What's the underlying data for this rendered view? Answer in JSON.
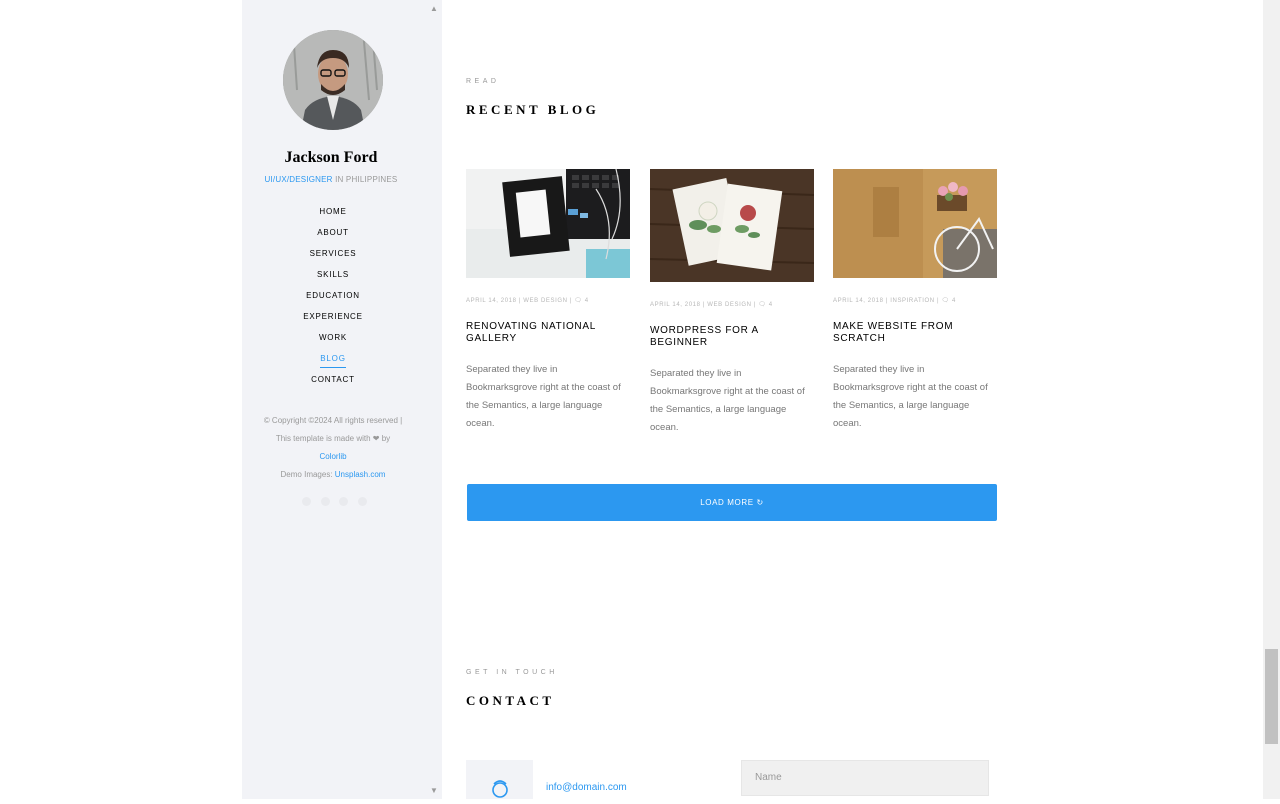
{
  "sidebar": {
    "name": "Jackson Ford",
    "role_accent": "UI/UX/DESIGNER",
    "role_rest": " IN PHILIPPINES",
    "nav": [
      {
        "label": "HOME"
      },
      {
        "label": "ABOUT"
      },
      {
        "label": "SERVICES"
      },
      {
        "label": "SKILLS"
      },
      {
        "label": "EDUCATION"
      },
      {
        "label": "EXPERIENCE"
      },
      {
        "label": "WORK"
      },
      {
        "label": "BLOG",
        "active": true
      },
      {
        "label": "CONTACT"
      }
    ],
    "footer": {
      "line1": "© Copyright ©2024 All rights reserved |",
      "line2": "This template is made with ❤ by",
      "colorlib": "Colorlib",
      "demo_prefix": "Demo Images: ",
      "demo_link": "Unsplash.com"
    },
    "social_icons": [
      "twitter-icon",
      "facebook-icon",
      "linkedin-icon",
      "dribbble-icon"
    ]
  },
  "blog": {
    "eyebrow": "READ",
    "title": "RECENT BLOG",
    "posts": [
      {
        "date": "APRIL 14, 2018",
        "category": "WEB DESIGN",
        "comments": "4",
        "title": "RENOVATING NATIONAL GALLERY",
        "excerpt": "Separated they live in Bookmarksgrove right at the coast of the Semantics, a large language ocean."
      },
      {
        "date": "APRIL 14, 2018",
        "category": "WEB DESIGN",
        "comments": "4",
        "title": "WORDPRESS FOR A BEGINNER",
        "excerpt": "Separated they live in Bookmarksgrove right at the coast of the Semantics, a large language ocean."
      },
      {
        "date": "APRIL 14, 2018",
        "category": "INSPIRATION",
        "comments": "4",
        "title": "MAKE WEBSITE FROM SCRATCH",
        "excerpt": "Separated they live in Bookmarksgrove right at the coast of the Semantics, a large language ocean."
      }
    ],
    "load_more": "LOAD MORE"
  },
  "contact": {
    "eyebrow": "GET IN TOUCH",
    "title": "CONTACT",
    "email": "info@domain.com",
    "name_placeholder": "Name"
  },
  "colors": {
    "accent": "#2c98f0",
    "sidebar_bg": "#f2f3f7"
  }
}
